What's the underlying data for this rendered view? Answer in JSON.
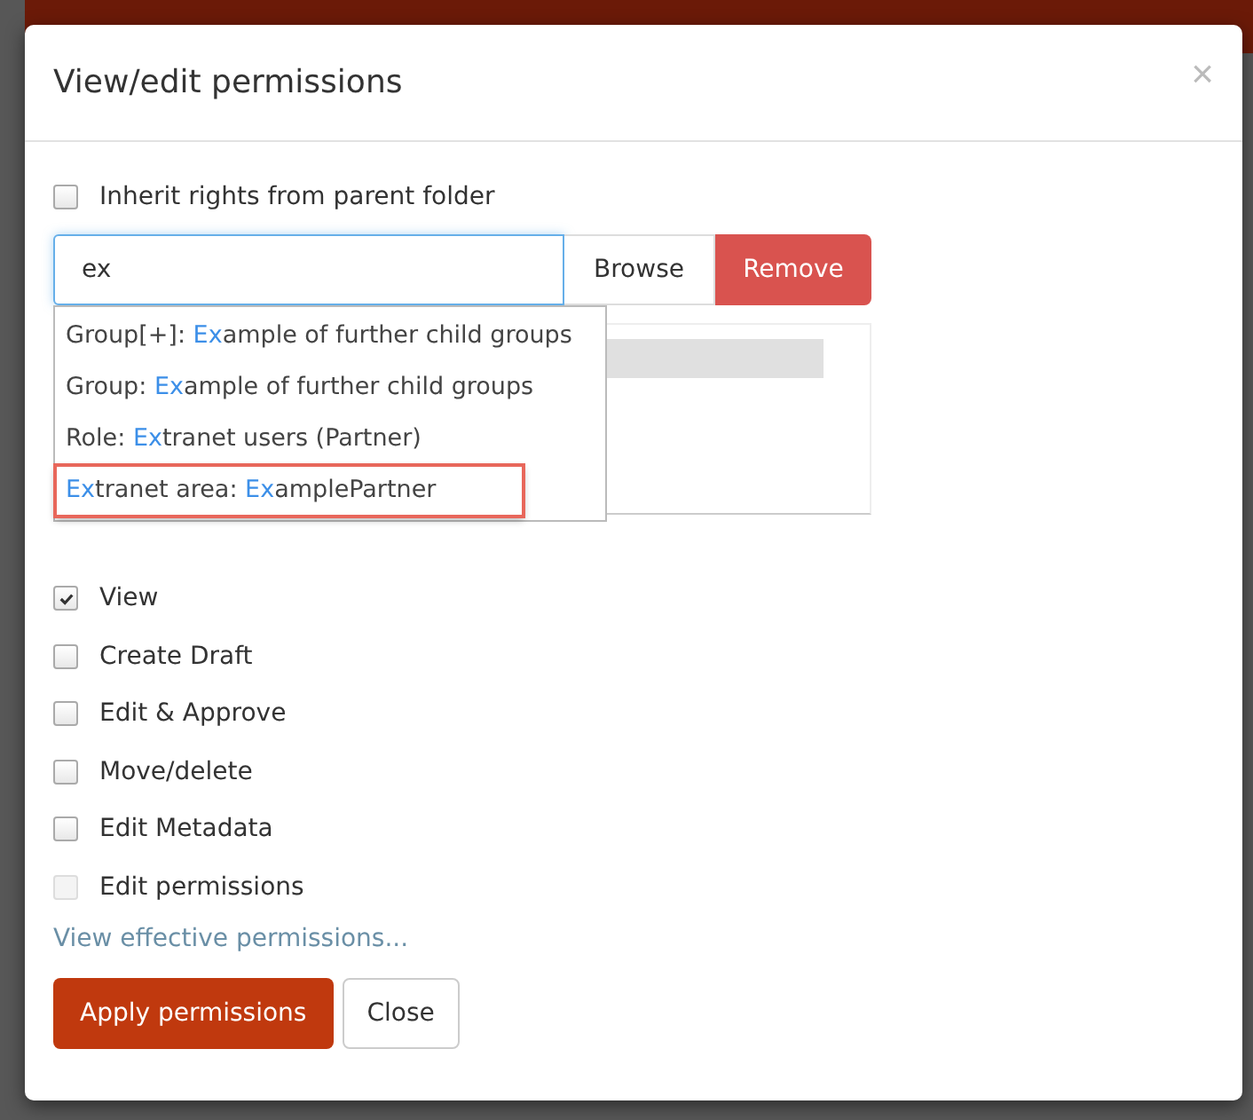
{
  "dialog": {
    "title": "View/edit permissions",
    "close_glyph": "×"
  },
  "inherit": {
    "label": "Inherit rights from parent folder",
    "checked": false
  },
  "search": {
    "value": "ex"
  },
  "buttons": {
    "browse": "Browse",
    "remove": "Remove"
  },
  "suggestions": [
    {
      "segments": [
        {
          "text": "Group[+]: ",
          "match": false
        },
        {
          "text": "Ex",
          "match": true
        },
        {
          "text": "ample of further child groups",
          "match": false
        }
      ],
      "annotated": false
    },
    {
      "segments": [
        {
          "text": "Group: ",
          "match": false
        },
        {
          "text": "Ex",
          "match": true
        },
        {
          "text": "ample of further child groups",
          "match": false
        }
      ],
      "annotated": false
    },
    {
      "segments": [
        {
          "text": "Role: ",
          "match": false
        },
        {
          "text": "Ex",
          "match": true
        },
        {
          "text": "tranet users (Partner)",
          "match": false
        }
      ],
      "annotated": false
    },
    {
      "segments": [
        {
          "text": "Ex",
          "match": true
        },
        {
          "text": "tranet area: ",
          "match": false
        },
        {
          "text": "Ex",
          "match": true
        },
        {
          "text": "amplePartner",
          "match": false
        }
      ],
      "annotated": true
    }
  ],
  "permissions": [
    {
      "label": "View",
      "checked": true,
      "disabled": false
    },
    {
      "label": "Create Draft",
      "checked": false,
      "disabled": false
    },
    {
      "label": "Edit & Approve",
      "checked": false,
      "disabled": false
    },
    {
      "label": "Move/delete",
      "checked": false,
      "disabled": false
    },
    {
      "label": "Edit Metadata",
      "checked": false,
      "disabled": false
    },
    {
      "label": "Edit permissions",
      "checked": false,
      "disabled": true
    }
  ],
  "effective_link": "View effective permissions...",
  "footer": {
    "apply": "Apply permissions",
    "close": "Close"
  }
}
